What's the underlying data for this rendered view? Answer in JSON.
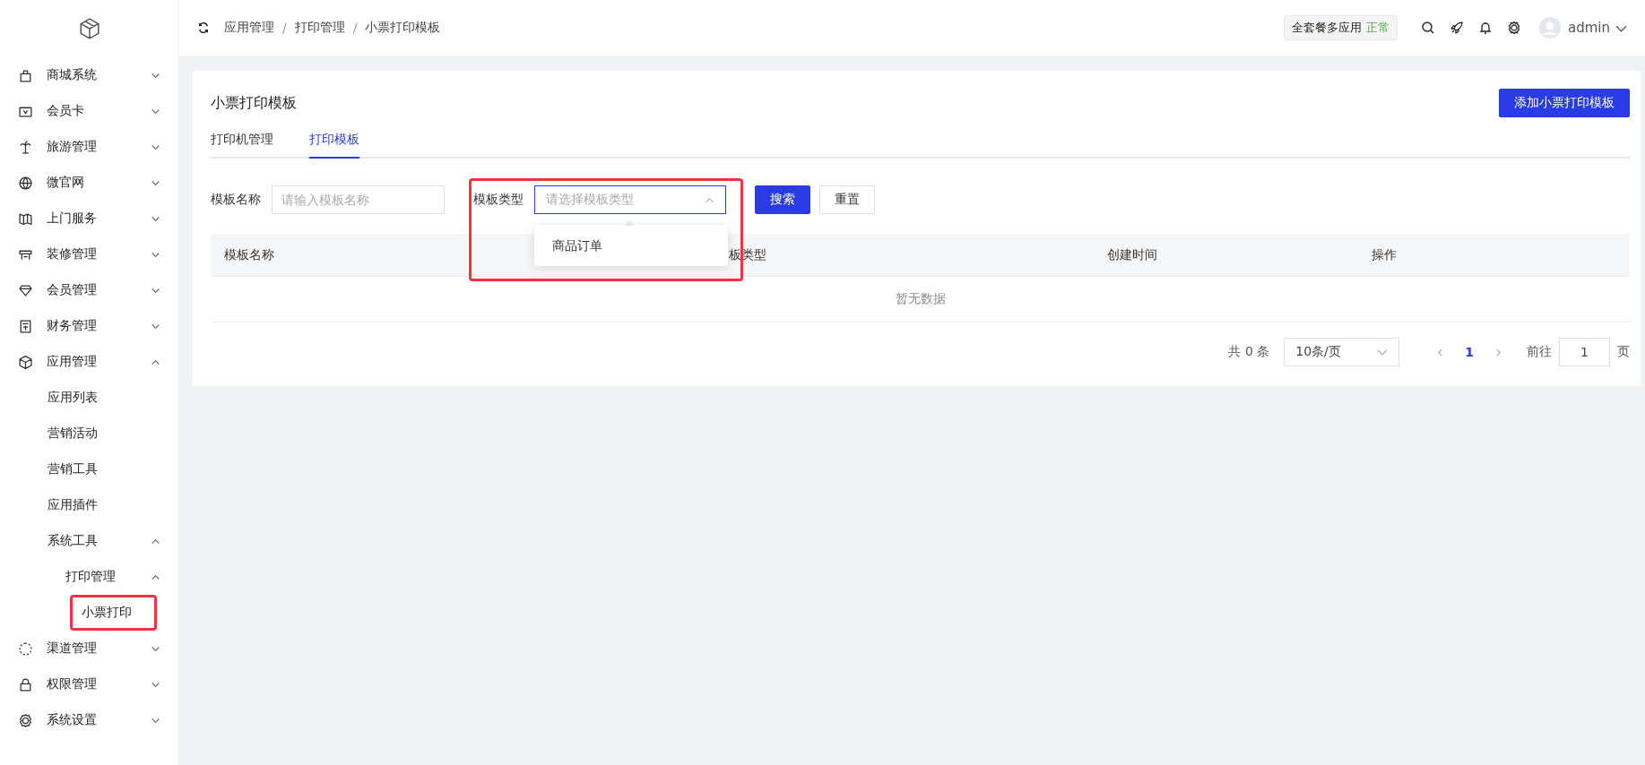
{
  "sidebar": {
    "items": [
      {
        "label": "商城系统",
        "expanded": false
      },
      {
        "label": "会员卡",
        "expanded": false
      },
      {
        "label": "旅游管理",
        "expanded": false
      },
      {
        "label": "微官网",
        "expanded": false
      },
      {
        "label": "上门服务",
        "expanded": false
      },
      {
        "label": "装修管理",
        "expanded": false
      },
      {
        "label": "会员管理",
        "expanded": false
      },
      {
        "label": "财务管理",
        "expanded": false
      },
      {
        "label": "应用管理",
        "expanded": true,
        "children": [
          {
            "label": "应用列表"
          },
          {
            "label": "营销活动"
          },
          {
            "label": "营销工具"
          },
          {
            "label": "应用插件"
          },
          {
            "label": "系统工具",
            "expanded": true,
            "children": [
              {
                "label": "打印管理",
                "expanded": true,
                "children": [
                  {
                    "label": "小票打印",
                    "highlighted": true
                  }
                ]
              }
            ]
          }
        ]
      },
      {
        "label": "渠道管理",
        "expanded": false
      },
      {
        "label": "权限管理",
        "expanded": false
      },
      {
        "label": "系统设置",
        "expanded": false
      }
    ]
  },
  "header": {
    "breadcrumbs": [
      "应用管理",
      "打印管理",
      "小票打印模板"
    ],
    "separator": "/",
    "plan": "全套餐多应用",
    "plan_status": "正常",
    "user": "admin"
  },
  "page": {
    "title": "小票打印模板",
    "add_button": "添加小票打印模板",
    "tabs": [
      {
        "label": "打印机管理",
        "selected": false
      },
      {
        "label": "打印模板",
        "selected": true
      }
    ],
    "filters": {
      "name_label": "模板名称",
      "name_placeholder": "请输入模板名称",
      "type_label": "模板类型",
      "type_placeholder": "请选择模板类型",
      "type_open": true,
      "type_highlighted": true,
      "type_options": [
        "商品订单"
      ],
      "search_button": "搜索",
      "reset_button": "重置"
    },
    "table": {
      "columns": [
        "模板名称",
        "板类型",
        "创建时间",
        "操作"
      ],
      "empty_text": "暂无数据"
    },
    "pagination": {
      "total": "共 0 条",
      "page_size": "10条/页",
      "pages": [
        {
          "label": "1",
          "selected": true
        }
      ],
      "goto_label": "前往",
      "goto_value": "1",
      "goto_suffix": "页"
    }
  }
}
